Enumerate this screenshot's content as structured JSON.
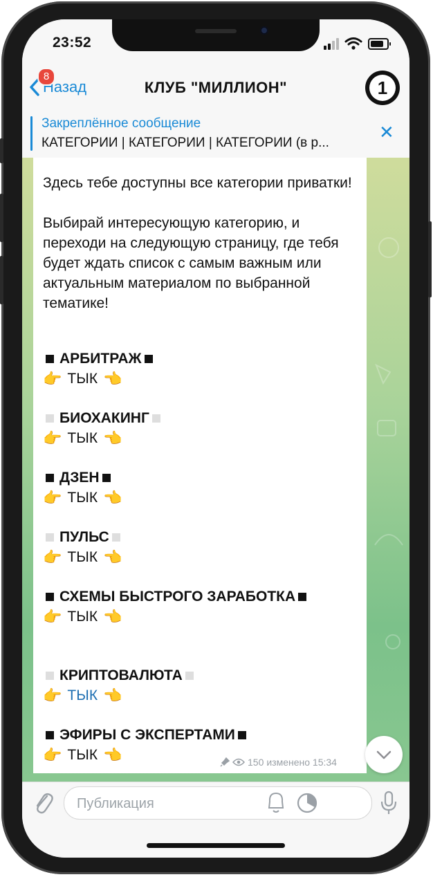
{
  "status_bar": {
    "time": "23:52"
  },
  "nav": {
    "back_label": "Назад",
    "badge_count": "8",
    "title": "КЛУБ \"МИЛЛИОН\"",
    "avatar_text": "1"
  },
  "pinned": {
    "title": "Закреплённое сообщение",
    "text": "КАТЕГОРИИ | КАТЕГОРИИ | КАТЕГОРИИ   (в р..."
  },
  "message": {
    "intro": "Здесь тебе доступны все категории приватки!",
    "intro2": "Выбирай интересующую категорию, и переходи на следующую страницу, где тебя будет ждать список с самым важным или актуальным материалом по выбранной тематике!",
    "link_label": "ТЫК",
    "categories": [
      {
        "name": "АРБИТРАЖ",
        "square": "black"
      },
      {
        "name": "БИОХАКИНГ",
        "square": "grey"
      },
      {
        "name": "ДЗЕН",
        "square": "black"
      },
      {
        "name": "ПУЛЬС",
        "square": "grey"
      },
      {
        "name": "СХЕМЫ БЫСТРОГО ЗАРАБОТКА",
        "square": "black"
      },
      {
        "name": "КРИПТОВАЛЮТА",
        "square": "grey"
      },
      {
        "name": "ЭФИРЫ С ЭКСПЕРТАМИ",
        "square": "black"
      }
    ],
    "views": "150",
    "edited": "изменено 15:34"
  },
  "input": {
    "placeholder": "Публикация"
  },
  "colors": {
    "accent": "#1a8ad6",
    "badge": "#e8463b",
    "link": "#1e6fb2"
  }
}
